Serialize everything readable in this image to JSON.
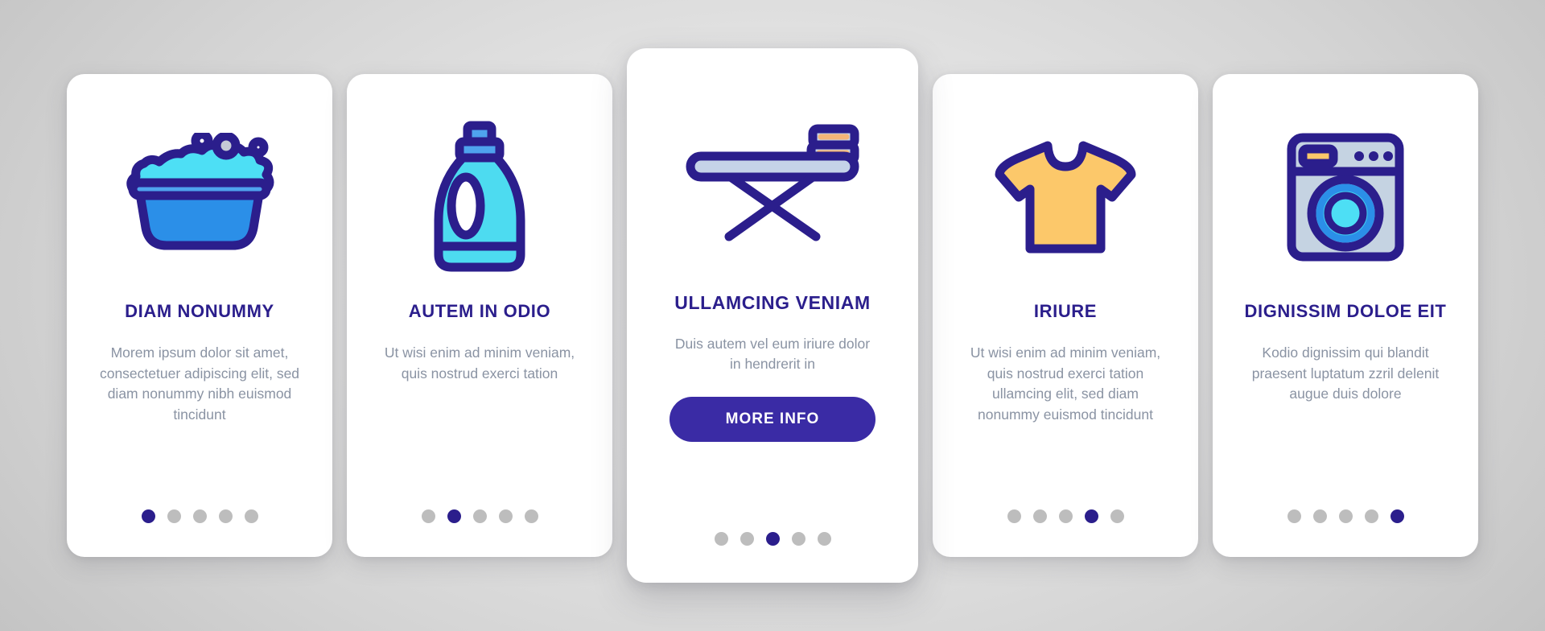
{
  "theme": {
    "accent_purple": "#2B1E8C",
    "button_purple": "#3A2BA5",
    "body_text_gray": "#8a93a3",
    "dot_inactive": "#bdbdbd",
    "card_bg": "#ffffff",
    "page_bg": "#e3e3e3",
    "icon_cyan": "#4DDBF0",
    "icon_blue": "#2B8FE8",
    "icon_yellow": "#FCC86A",
    "icon_light_blue_gray": "#C5D3E2"
  },
  "cards": [
    {
      "icon": "wash-basin-foam-icon",
      "title": "DIAM NONUMMY",
      "body": "Morem ipsum dolor sit amet, consectetuer adipiscing elit, sed diam nonummy nibh euismod tincidunt",
      "dots_total": 5,
      "dot_active_index": 0,
      "featured": false,
      "button_label": null
    },
    {
      "icon": "detergent-bottle-icon",
      "title": "AUTEM IN ODIO",
      "body": "Ut wisi enim ad minim veniam, quis nostrud exerci tation",
      "dots_total": 5,
      "dot_active_index": 1,
      "featured": false,
      "button_label": null
    },
    {
      "icon": "ironing-board-icon",
      "title": "ULLAMCING VENIAM",
      "body": "Duis autem vel eum iriure dolor in hendrerit in",
      "dots_total": 5,
      "dot_active_index": 2,
      "featured": true,
      "button_label": "MORE INFO"
    },
    {
      "icon": "tshirt-icon",
      "title": "IRIURE",
      "body": "Ut wisi enim ad minim veniam, quis nostrud exerci tation ullamcing elit, sed diam nonummy euismod tincidunt",
      "dots_total": 5,
      "dot_active_index": 3,
      "featured": false,
      "button_label": null
    },
    {
      "icon": "washing-machine-icon",
      "title": "DIGNISSIM DOLOE EIT",
      "body": "Kodio dignissim qui blandit praesent luptatum zzril delenit augue duis dolore",
      "dots_total": 5,
      "dot_active_index": 4,
      "featured": false,
      "button_label": null
    }
  ]
}
